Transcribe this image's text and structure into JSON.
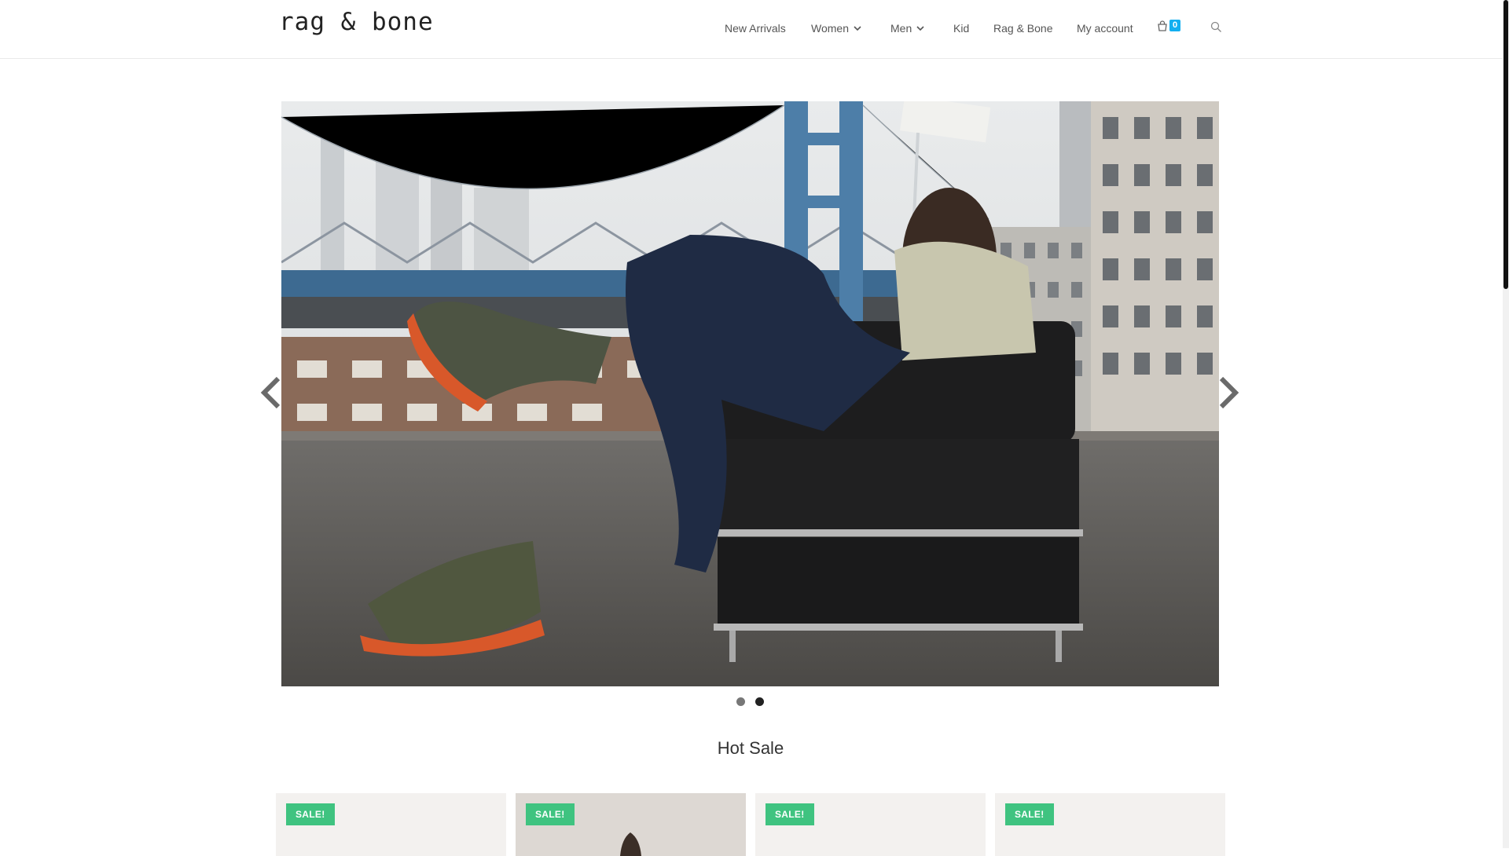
{
  "brand": {
    "logo_text": "rag & bone"
  },
  "nav": {
    "items": [
      {
        "label": "New Arrivals",
        "has_dropdown": false
      },
      {
        "label": "Women",
        "has_dropdown": true
      },
      {
        "label": "Men",
        "has_dropdown": true
      },
      {
        "label": "Kid",
        "has_dropdown": false
      },
      {
        "label": "Rag & Bone",
        "has_dropdown": false
      },
      {
        "label": "My account",
        "has_dropdown": false
      }
    ],
    "cart_count": "0",
    "cart_icon": "shopping-bag-icon",
    "search_icon": "search-icon"
  },
  "slider": {
    "slide_count": 2,
    "active_index": 2,
    "prev_icon": "chevron-left-icon",
    "next_icon": "chevron-right-icon"
  },
  "hot_sale": {
    "title": "Hot Sale",
    "products": [
      {
        "badge": "SALE!"
      },
      {
        "badge": "SALE!"
      },
      {
        "badge": "SALE!"
      },
      {
        "badge": "SALE!"
      }
    ]
  },
  "colors": {
    "accent": "#13aff0",
    "sale_badge": "#3fc380",
    "text": "#555555"
  }
}
